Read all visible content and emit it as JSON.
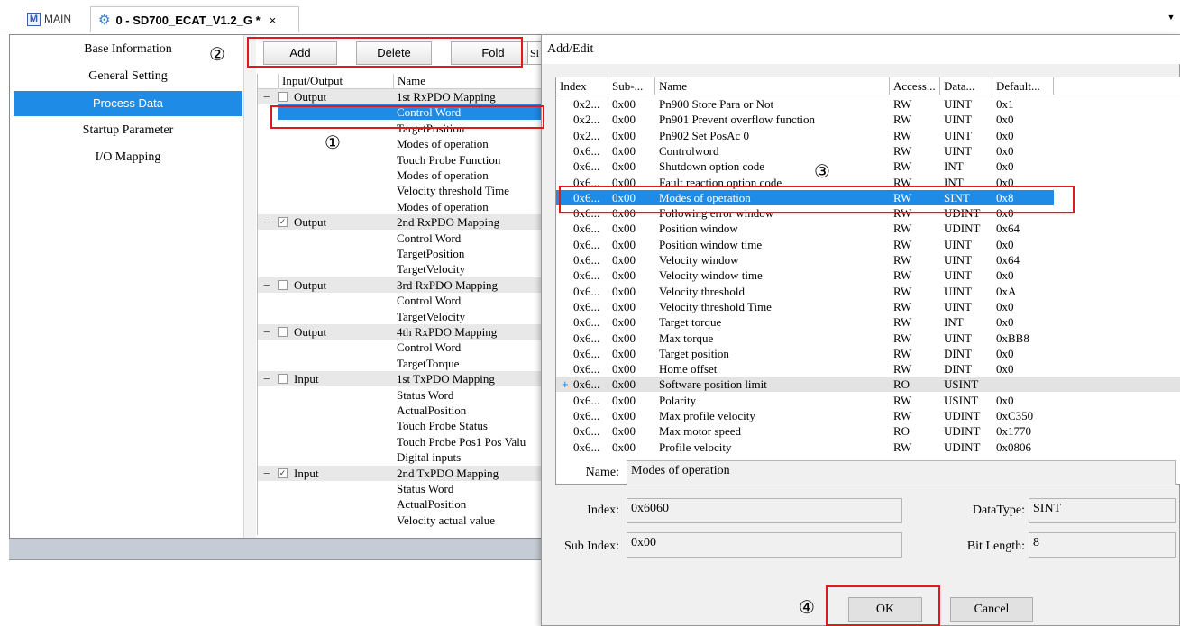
{
  "tabs": {
    "main_label": "MAIN",
    "main_icon": "m-icon",
    "active_icon": "gear-icon",
    "active_label": "0 - SD700_ECAT_V1.2_G *",
    "close_glyph": "×"
  },
  "sidebar": {
    "items": [
      {
        "label": "Base Information",
        "active": false
      },
      {
        "label": "General Setting",
        "active": false
      },
      {
        "label": "Process Data",
        "active": true
      },
      {
        "label": "Startup Parameter",
        "active": false
      },
      {
        "label": "I/O Mapping",
        "active": false
      }
    ]
  },
  "toolbar": {
    "add_label": "Add",
    "delete_label": "Delete",
    "fold_label": "Fold",
    "extra_label": "Sl"
  },
  "pdo_grid": {
    "headers": {
      "io": "Input/Output",
      "name": "Name"
    },
    "rows": [
      {
        "group": true,
        "checked": false,
        "io": "Output",
        "name": "1st RxPDO Mapping"
      },
      {
        "group": false,
        "selected": true,
        "io": "",
        "name": "Control Word"
      },
      {
        "group": false,
        "io": "",
        "name": "TargetPosition"
      },
      {
        "group": false,
        "io": "",
        "name": "Modes of operation"
      },
      {
        "group": false,
        "io": "",
        "name": "Touch Probe Function"
      },
      {
        "group": false,
        "io": "",
        "name": "Modes of operation"
      },
      {
        "group": false,
        "io": "",
        "name": "Velocity threshold Time"
      },
      {
        "group": false,
        "io": "",
        "name": "Modes of operation"
      },
      {
        "group": true,
        "checked": true,
        "io": "Output",
        "name": "2nd RxPDO Mapping"
      },
      {
        "group": false,
        "io": "",
        "name": "Control Word"
      },
      {
        "group": false,
        "io": "",
        "name": "TargetPosition"
      },
      {
        "group": false,
        "io": "",
        "name": "TargetVelocity"
      },
      {
        "group": true,
        "checked": false,
        "io": "Output",
        "name": "3rd RxPDO Mapping"
      },
      {
        "group": false,
        "io": "",
        "name": "Control Word"
      },
      {
        "group": false,
        "io": "",
        "name": "TargetVelocity"
      },
      {
        "group": true,
        "checked": false,
        "io": "Output",
        "name": "4th RxPDO Mapping"
      },
      {
        "group": false,
        "io": "",
        "name": "Control Word"
      },
      {
        "group": false,
        "io": "",
        "name": "TargetTorque"
      },
      {
        "group": true,
        "checked": false,
        "io": "Input",
        "name": "1st TxPDO Mapping"
      },
      {
        "group": false,
        "io": "",
        "name": "Status Word"
      },
      {
        "group": false,
        "io": "",
        "name": "ActualPosition"
      },
      {
        "group": false,
        "io": "",
        "name": "Touch Probe Status"
      },
      {
        "group": false,
        "io": "",
        "name": "Touch Probe Pos1 Pos Valu"
      },
      {
        "group": false,
        "io": "",
        "name": "Digital inputs"
      },
      {
        "group": true,
        "checked": true,
        "io": "Input",
        "name": "2nd TxPDO Mapping"
      },
      {
        "group": false,
        "io": "",
        "name": "Status Word"
      },
      {
        "group": false,
        "io": "",
        "name": "ActualPosition"
      },
      {
        "group": false,
        "io": "",
        "name": "Velocity actual value"
      }
    ]
  },
  "dialog": {
    "title": "Add/Edit",
    "columns": [
      "Index",
      "Sub-...",
      "Name",
      "Access...",
      "Data...",
      "Default..."
    ],
    "rows": [
      {
        "index": "0x2...",
        "sub": "0x00",
        "name": "Pn900 Store Para or Not",
        "access": "RW",
        "data": "UINT",
        "def": "0x1"
      },
      {
        "index": "0x2...",
        "sub": "0x00",
        "name": "Pn901 Prevent overflow function",
        "access": "RW",
        "data": "UINT",
        "def": "0x0"
      },
      {
        "index": "0x2...",
        "sub": "0x00",
        "name": "Pn902 Set PosAc 0",
        "access": "RW",
        "data": "UINT",
        "def": "0x0"
      },
      {
        "index": "0x6...",
        "sub": "0x00",
        "name": "Controlword",
        "access": "RW",
        "data": "UINT",
        "def": "0x0"
      },
      {
        "index": "0x6...",
        "sub": "0x00",
        "name": "Shutdown option code",
        "access": "RW",
        "data": "INT",
        "def": "0x0"
      },
      {
        "index": "0x6...",
        "sub": "0x00",
        "name": "Fault reaction option code",
        "access": "RW",
        "data": "INT",
        "def": "0x0"
      },
      {
        "index": "0x6...",
        "sub": "0x00",
        "name": "Modes of operation",
        "access": "RW",
        "data": "SINT",
        "def": "0x8",
        "selected": true
      },
      {
        "index": "0x6...",
        "sub": "0x00",
        "name": "Following error window",
        "access": "RW",
        "data": "UDINT",
        "def": "0x0"
      },
      {
        "index": "0x6...",
        "sub": "0x00",
        "name": "Position window",
        "access": "RW",
        "data": "UDINT",
        "def": "0x64"
      },
      {
        "index": "0x6...",
        "sub": "0x00",
        "name": "Position window time",
        "access": "RW",
        "data": "UINT",
        "def": "0x0"
      },
      {
        "index": "0x6...",
        "sub": "0x00",
        "name": "Velocity window",
        "access": "RW",
        "data": "UINT",
        "def": "0x64"
      },
      {
        "index": "0x6...",
        "sub": "0x00",
        "name": "Velocity window time",
        "access": "RW",
        "data": "UINT",
        "def": "0x0"
      },
      {
        "index": "0x6...",
        "sub": "0x00",
        "name": "Velocity threshold",
        "access": "RW",
        "data": "UINT",
        "def": "0xA"
      },
      {
        "index": "0x6...",
        "sub": "0x00",
        "name": "Velocity threshold Time",
        "access": "RW",
        "data": "UINT",
        "def": "0x0"
      },
      {
        "index": "0x6...",
        "sub": "0x00",
        "name": "Target torque",
        "access": "RW",
        "data": "INT",
        "def": "0x0"
      },
      {
        "index": "0x6...",
        "sub": "0x00",
        "name": "Max torque",
        "access": "RW",
        "data": "UINT",
        "def": "0xBB8"
      },
      {
        "index": "0x6...",
        "sub": "0x00",
        "name": "Target position",
        "access": "RW",
        "data": "DINT",
        "def": "0x0"
      },
      {
        "index": "0x6...",
        "sub": "0x00",
        "name": "Home offset",
        "access": "RW",
        "data": "DINT",
        "def": "0x0"
      },
      {
        "index": "0x6...",
        "sub": "0x00",
        "name": "Software position limit",
        "access": "RO",
        "data": "USINT",
        "def": "",
        "expandable": true
      },
      {
        "index": "0x6...",
        "sub": "0x00",
        "name": "Polarity",
        "access": "RW",
        "data": "USINT",
        "def": "0x0"
      },
      {
        "index": "0x6...",
        "sub": "0x00",
        "name": "Max profile velocity",
        "access": "RW",
        "data": "UDINT",
        "def": "0xC350"
      },
      {
        "index": "0x6...",
        "sub": "0x00",
        "name": "Max motor speed",
        "access": "RO",
        "data": "UDINT",
        "def": "0x1770"
      },
      {
        "index": "0x6...",
        "sub": "0x00",
        "name": "Profile velocity",
        "access": "RW",
        "data": "UDINT",
        "def": "0x0806"
      }
    ],
    "fields": {
      "name_label": "Name:",
      "name_value": "Modes of operation",
      "index_label": "Index:",
      "index_value": "0x6060",
      "datatype_label": "DataType:",
      "datatype_value": "SINT",
      "subindex_label": "Sub Index:",
      "subindex_value": "0x00",
      "bitlength_label": "Bit Length:",
      "bitlength_value": "8"
    },
    "ok_label": "OK",
    "cancel_label": "Cancel"
  },
  "annotations": [
    "①",
    "②",
    "③",
    "④"
  ],
  "colors": {
    "selection": "#1e8be6",
    "annotation": "#e0191e"
  }
}
